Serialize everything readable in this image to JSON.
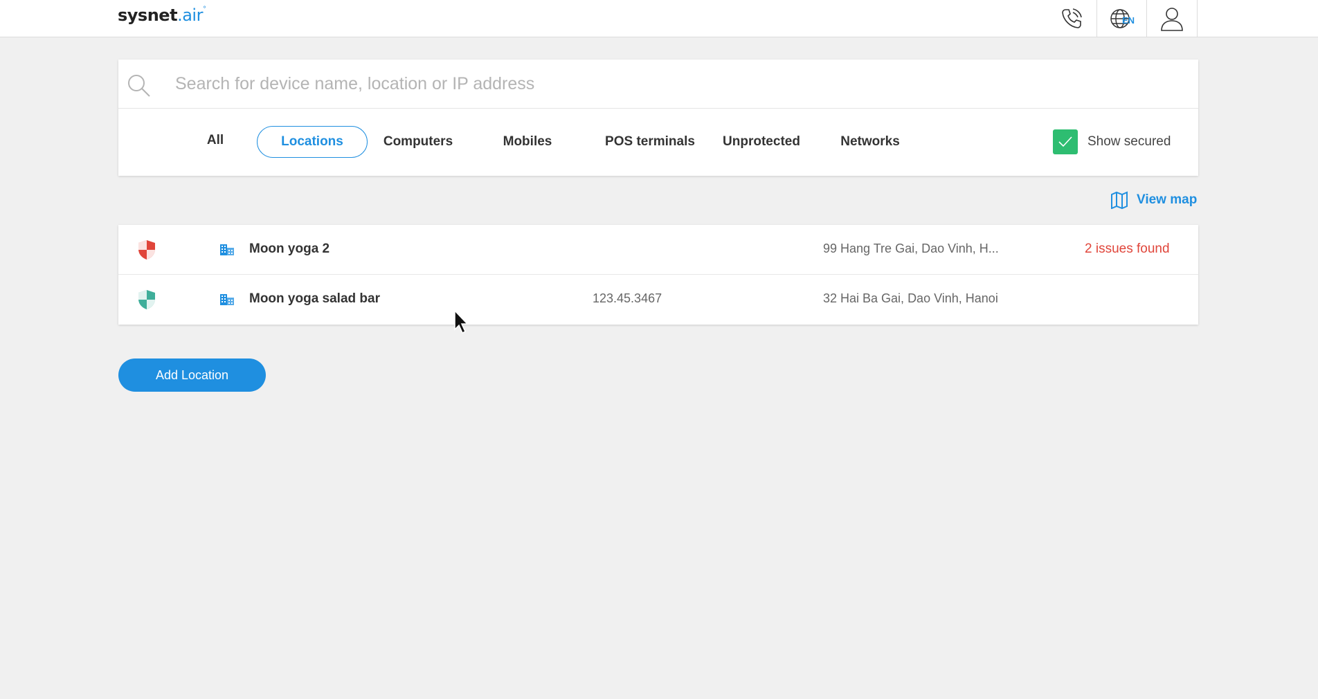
{
  "header": {
    "logo_main": "sysnet",
    "logo_dot": ".",
    "logo_air": "air",
    "logo_mark": "°",
    "phone_icon": "phone-icon",
    "language_code": "EN",
    "language_icon": "globe-icon",
    "user_icon": "user-icon"
  },
  "search": {
    "placeholder": "Search for device name, location or IP address",
    "value": ""
  },
  "tabs": [
    {
      "label": "All",
      "active": false
    },
    {
      "label": "Locations",
      "active": true
    },
    {
      "label": "Computers",
      "active": false
    },
    {
      "label": "Mobiles",
      "active": false
    },
    {
      "label": "POS terminals",
      "active": false
    },
    {
      "label": "Unprotected",
      "active": false
    },
    {
      "label": "Networks",
      "active": false
    }
  ],
  "show_secured": {
    "label": "Show secured",
    "checked": true
  },
  "view_map": {
    "label": "View map"
  },
  "locations": [
    {
      "name": "Moon yoga 2",
      "ip": "",
      "address": "99 Hang Tre Gai, Dao Vinh, H...",
      "status": "2 issues found",
      "secure": false
    },
    {
      "name": "Moon yoga salad bar",
      "ip": "123.45.3467",
      "address": "32 Hai Ba Gai, Dao Vinh, Hanoi",
      "status": "",
      "secure": true
    }
  ],
  "add_location": {
    "label": "Add Location"
  },
  "colors": {
    "accent": "#1f8fe0",
    "danger": "#e0453a",
    "secure": "#3fae9a",
    "checkbox": "#2ebd71",
    "background": "#f0f0f0"
  }
}
